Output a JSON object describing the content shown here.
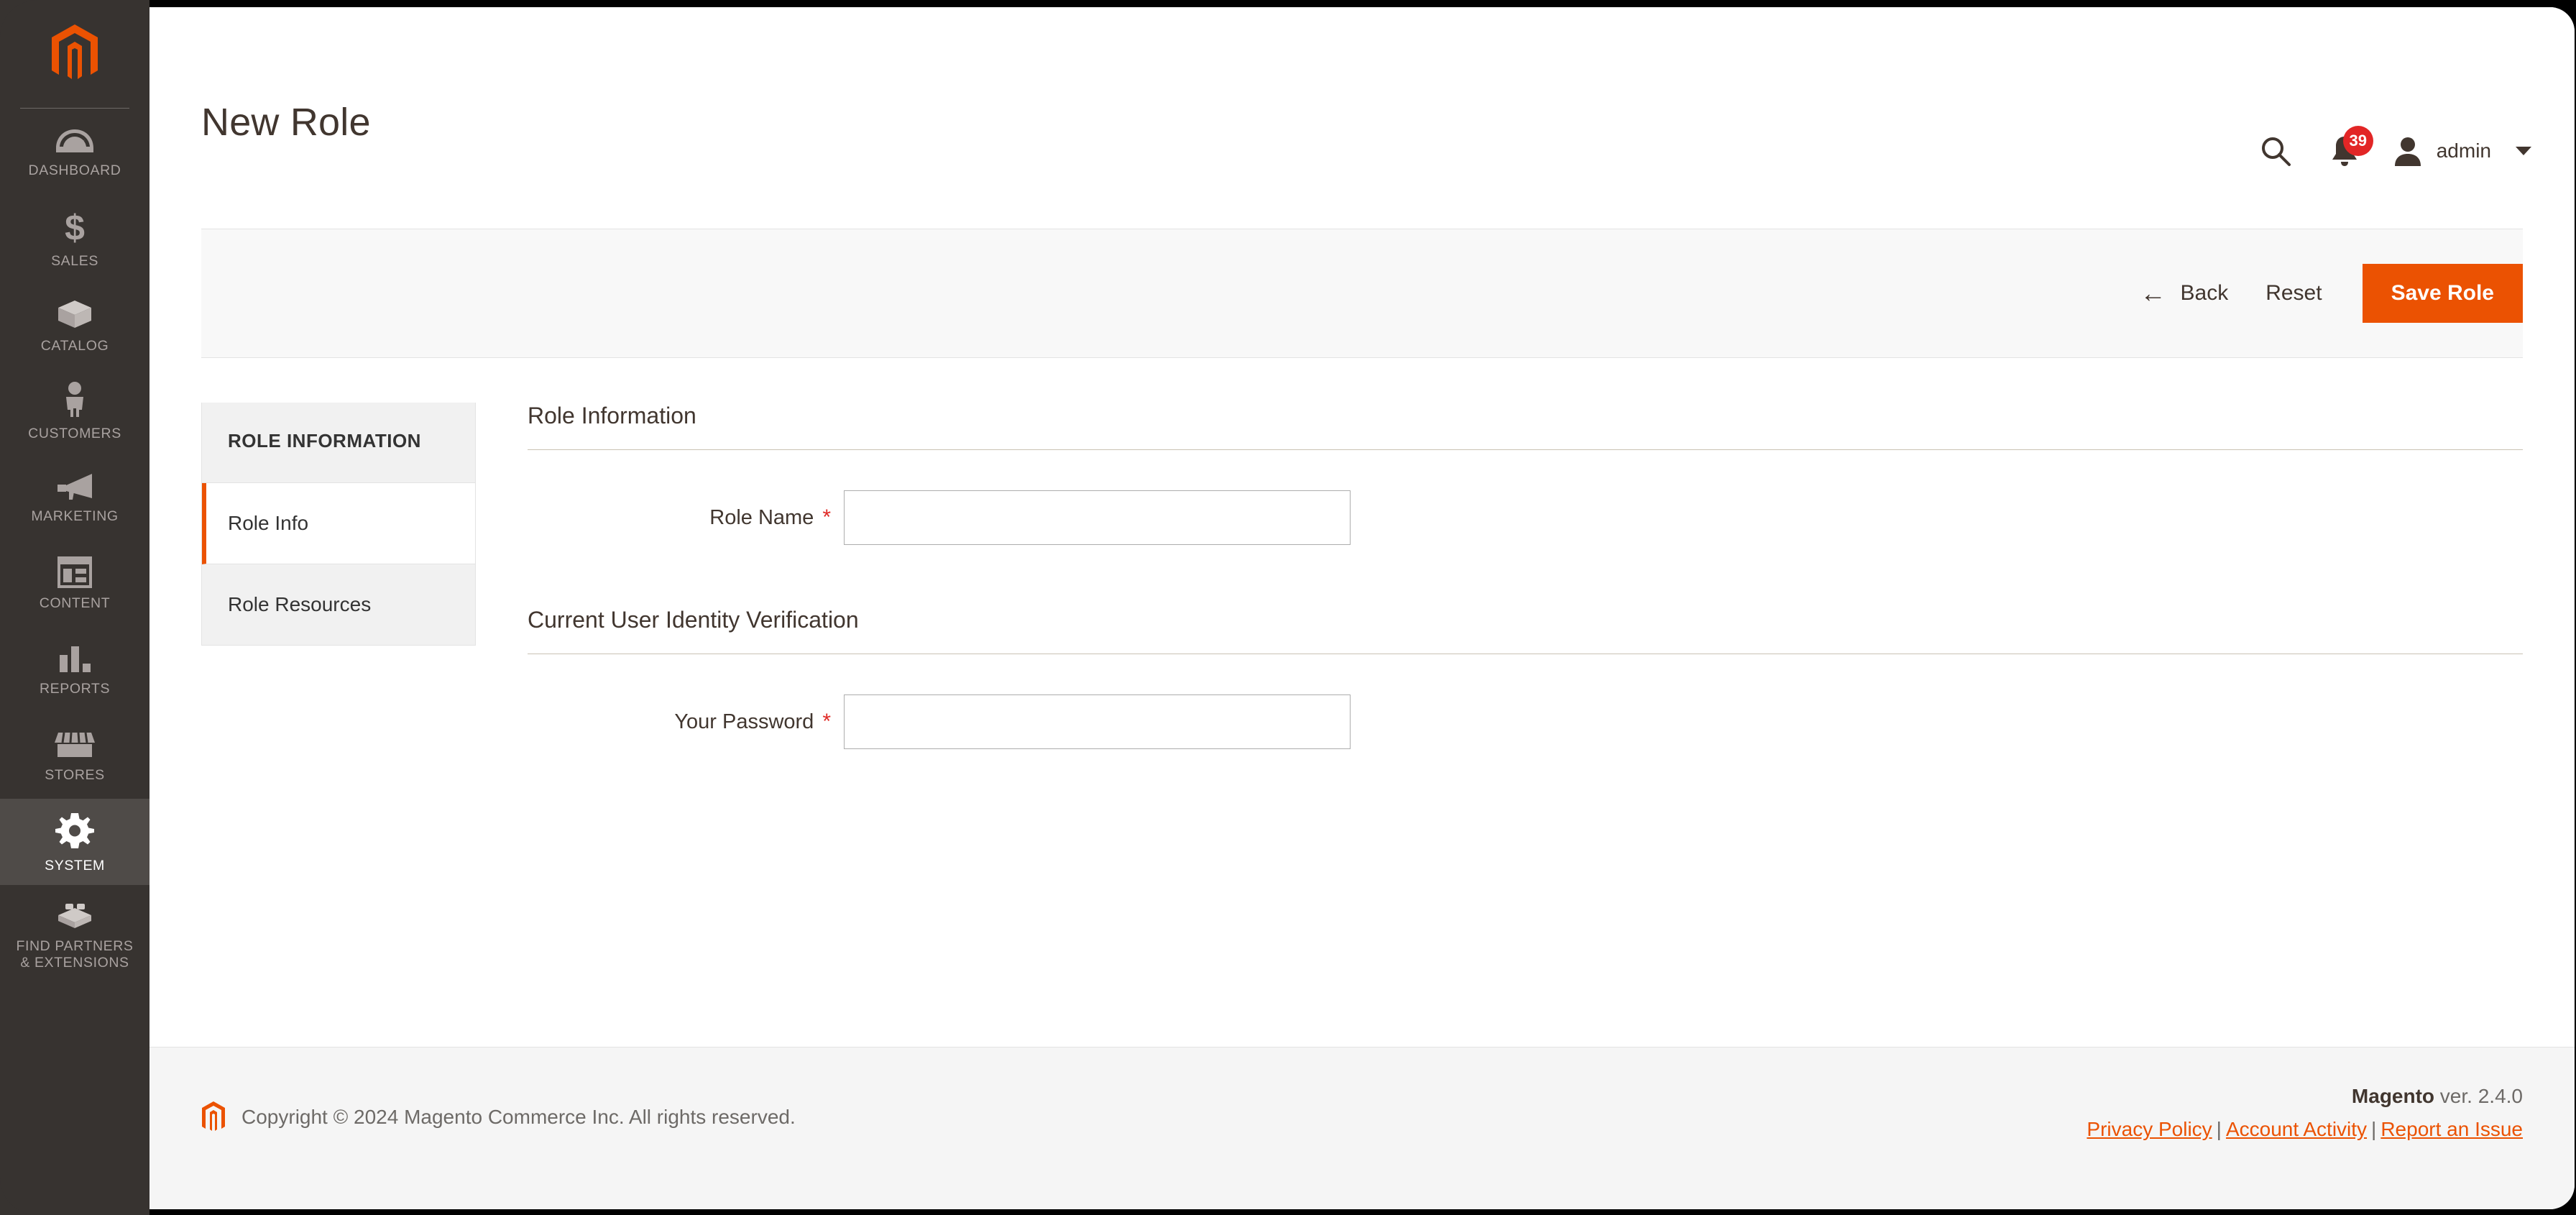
{
  "sidebar": {
    "logo_name": "magento-logo",
    "items": [
      {
        "label": "DASHBOARD",
        "icon": "dashboard-gauge-icon",
        "active": false
      },
      {
        "label": "SALES",
        "icon": "dollar-sign-icon",
        "active": false
      },
      {
        "label": "CATALOG",
        "icon": "box-package-icon",
        "active": false
      },
      {
        "label": "CUSTOMERS",
        "icon": "person-icon",
        "active": false
      },
      {
        "label": "MARKETING",
        "icon": "megaphone-icon",
        "active": false
      },
      {
        "label": "CONTENT",
        "icon": "layout-page-icon",
        "active": false
      },
      {
        "label": "REPORTS",
        "icon": "bar-chart-icon",
        "active": false
      },
      {
        "label": "STORES",
        "icon": "storefront-icon",
        "active": false
      },
      {
        "label": "SYSTEM",
        "icon": "gear-icon",
        "active": true
      },
      {
        "label": "FIND PARTNERS\n& EXTENSIONS",
        "icon": "blocks-icon",
        "active": false
      }
    ]
  },
  "header": {
    "title": "New Role",
    "search_icon": "search-icon",
    "notifications_icon": "bell-icon",
    "notifications_count": "39",
    "avatar_icon": "user-avatar-icon",
    "user_name": "admin",
    "caret_icon": "chevron-down-icon"
  },
  "toolbar": {
    "back_label": "Back",
    "back_icon": "arrow-left-icon",
    "reset_label": "Reset",
    "save_label": "Save Role"
  },
  "tabs_panel": {
    "title": "ROLE INFORMATION",
    "items": [
      {
        "label": "Role Info",
        "active": true
      },
      {
        "label": "Role Resources",
        "active": false
      }
    ]
  },
  "form": {
    "sections": [
      {
        "legend": "Role Information",
        "fields": [
          {
            "label": "Role Name",
            "required": "*",
            "value": "",
            "placeholder": ""
          }
        ]
      },
      {
        "legend": "Current User Identity Verification",
        "fields": [
          {
            "label": "Your Password",
            "required": "*",
            "value": "",
            "placeholder": ""
          }
        ]
      }
    ]
  },
  "footer": {
    "logo_icon": "magento-footer-logo",
    "copyright": "Copyright © 2024 Magento Commerce Inc. All rights reserved.",
    "brand": "Magento",
    "version": " ver. 2.4.0",
    "links": [
      {
        "label": "Privacy Policy"
      },
      {
        "label": "Account Activity"
      },
      {
        "label": "Report an Issue"
      }
    ],
    "separator": "|"
  },
  "colors": {
    "accent_orange": "#eb5202",
    "sidebar_bg": "#373330",
    "sidebar_active": "#4f4b48",
    "badge_red": "#e22626",
    "required_red": "#e02b27",
    "text_dark": "#41362f"
  }
}
